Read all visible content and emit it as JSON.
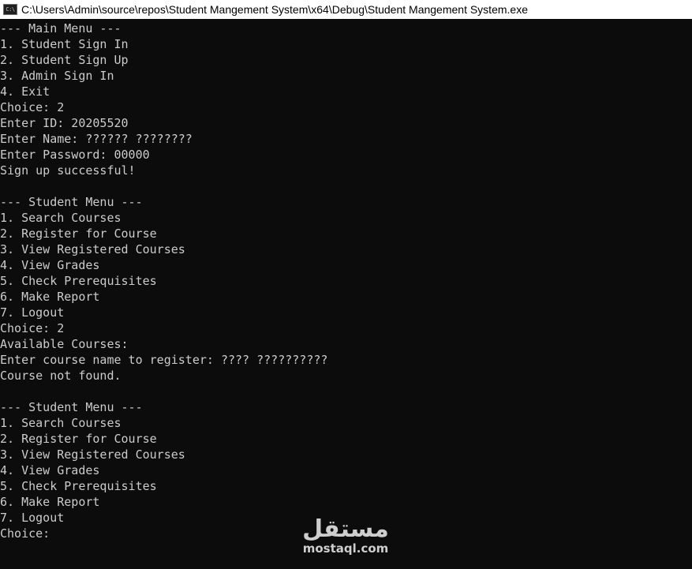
{
  "window": {
    "title": "C:\\Users\\Admin\\source\\repos\\Student Mangement System\\x64\\Debug\\Student Mangement System.exe",
    "icon_label": "C:\\",
    "icon": "console-app-icon"
  },
  "console": {
    "lines": [
      "--- Main Menu ---",
      "1. Student Sign In",
      "2. Student Sign Up",
      "3. Admin Sign In",
      "4. Exit",
      "Choice: 2",
      "Enter ID: 20205520",
      "Enter Name: ?????? ????????",
      "Enter Password: 00000",
      "Sign up successful!",
      "",
      "--- Student Menu ---",
      "1. Search Courses",
      "2. Register for Course",
      "3. View Registered Courses",
      "4. View Grades",
      "5. Check Prerequisites",
      "6. Make Report",
      "7. Logout",
      "Choice: 2",
      "Available Courses:",
      "Enter course name to register: ???? ??????????",
      "Course not found.",
      "",
      "--- Student Menu ---",
      "1. Search Courses",
      "2. Register for Course",
      "3. View Registered Courses",
      "4. View Grades",
      "5. Check Prerequisites",
      "6. Make Report",
      "7. Logout",
      "Choice:"
    ]
  },
  "watermark": {
    "arabic": "مستقل",
    "latin": "mostaql.com"
  },
  "colors": {
    "console_background": "#0c0c0c",
    "console_text": "#cccccc",
    "titlebar_background": "#ffffff"
  }
}
